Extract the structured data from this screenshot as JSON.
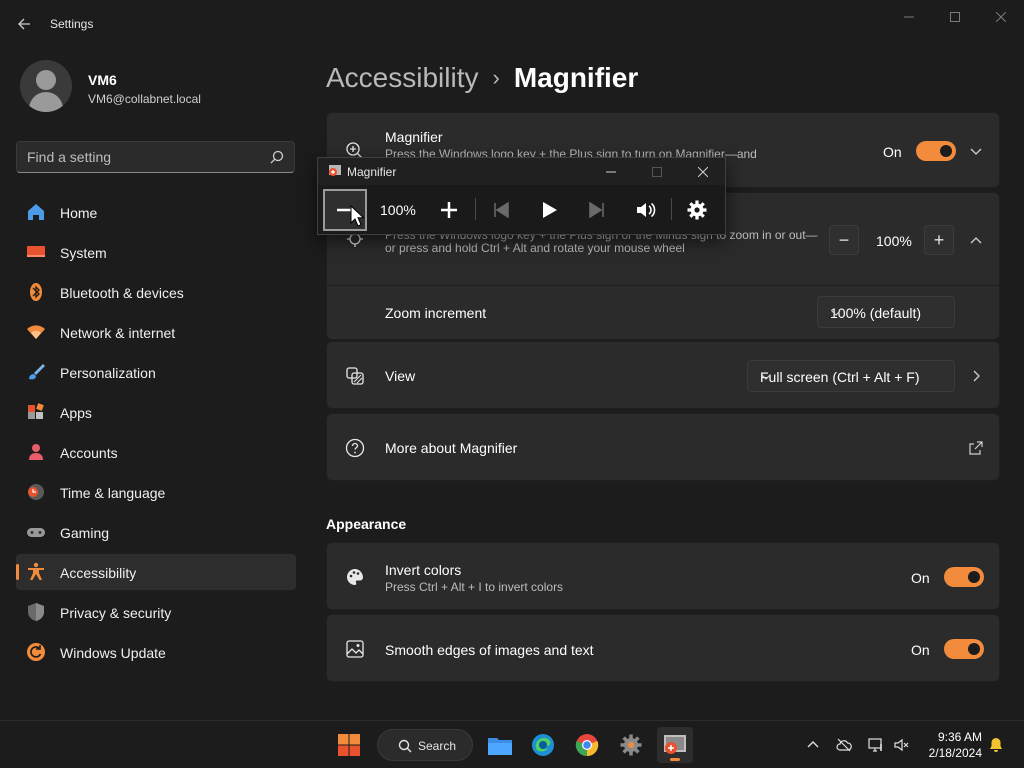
{
  "window": {
    "title": "Settings",
    "controls": [
      "minimize",
      "maximize",
      "close"
    ]
  },
  "profile": {
    "name": "VM6",
    "email": "VM6@collabnet.local"
  },
  "search": {
    "placeholder": "Find a setting"
  },
  "sidebar": {
    "items": [
      {
        "label": "Home",
        "icon": "home-icon"
      },
      {
        "label": "System",
        "icon": "system-icon"
      },
      {
        "label": "Bluetooth & devices",
        "icon": "bluetooth-icon"
      },
      {
        "label": "Network & internet",
        "icon": "wifi-icon"
      },
      {
        "label": "Personalization",
        "icon": "brush-icon"
      },
      {
        "label": "Apps",
        "icon": "apps-icon"
      },
      {
        "label": "Accounts",
        "icon": "person-icon"
      },
      {
        "label": "Time & language",
        "icon": "clock-globe-icon"
      },
      {
        "label": "Gaming",
        "icon": "gamepad-icon"
      },
      {
        "label": "Accessibility",
        "icon": "accessibility-icon",
        "selected": true
      },
      {
        "label": "Privacy & security",
        "icon": "shield-icon"
      },
      {
        "label": "Windows Update",
        "icon": "update-icon"
      }
    ]
  },
  "breadcrumb": {
    "parent": "Accessibility",
    "separator": "›",
    "current": "Magnifier"
  },
  "main": {
    "magnifier_card": {
      "title": "Magnifier",
      "description": "Press the Windows logo key  + the Plus sign to turn on Magnifier—and",
      "state": "On"
    },
    "zoom_card": {
      "description": "Press the Windows logo key  + the Plus sign or the Minus sign to zoom in or out—or press and hold Ctrl + Alt and rotate your mouse wheel",
      "value": "100%",
      "minus": "−",
      "plus": "+"
    },
    "zoom_increment": {
      "title": "Zoom increment",
      "value": "100% (default)"
    },
    "view_card": {
      "title": "View",
      "value": "Full screen (Ctrl + Alt + F)"
    },
    "more_card": {
      "title": "More about Magnifier"
    },
    "appearance": {
      "heading": "Appearance",
      "invert": {
        "title": "Invert colors",
        "description": "Press Ctrl + Alt + I to invert colors",
        "state": "On"
      },
      "smooth": {
        "title": "Smooth edges of images and text",
        "state": "On"
      }
    }
  },
  "magnifier_window": {
    "title": "Magnifier",
    "zoom": "100%",
    "buttons": [
      "zoom-out",
      "zoom-in",
      "previous",
      "play",
      "next",
      "read-from-here",
      "settings"
    ]
  },
  "taskbar": {
    "search_label": "Search",
    "time": "9:36 AM",
    "date": "2/18/2024"
  },
  "colors": {
    "accent": "#f28b3b",
    "background": "#1c1c1c",
    "card": "#2b2b2b"
  }
}
